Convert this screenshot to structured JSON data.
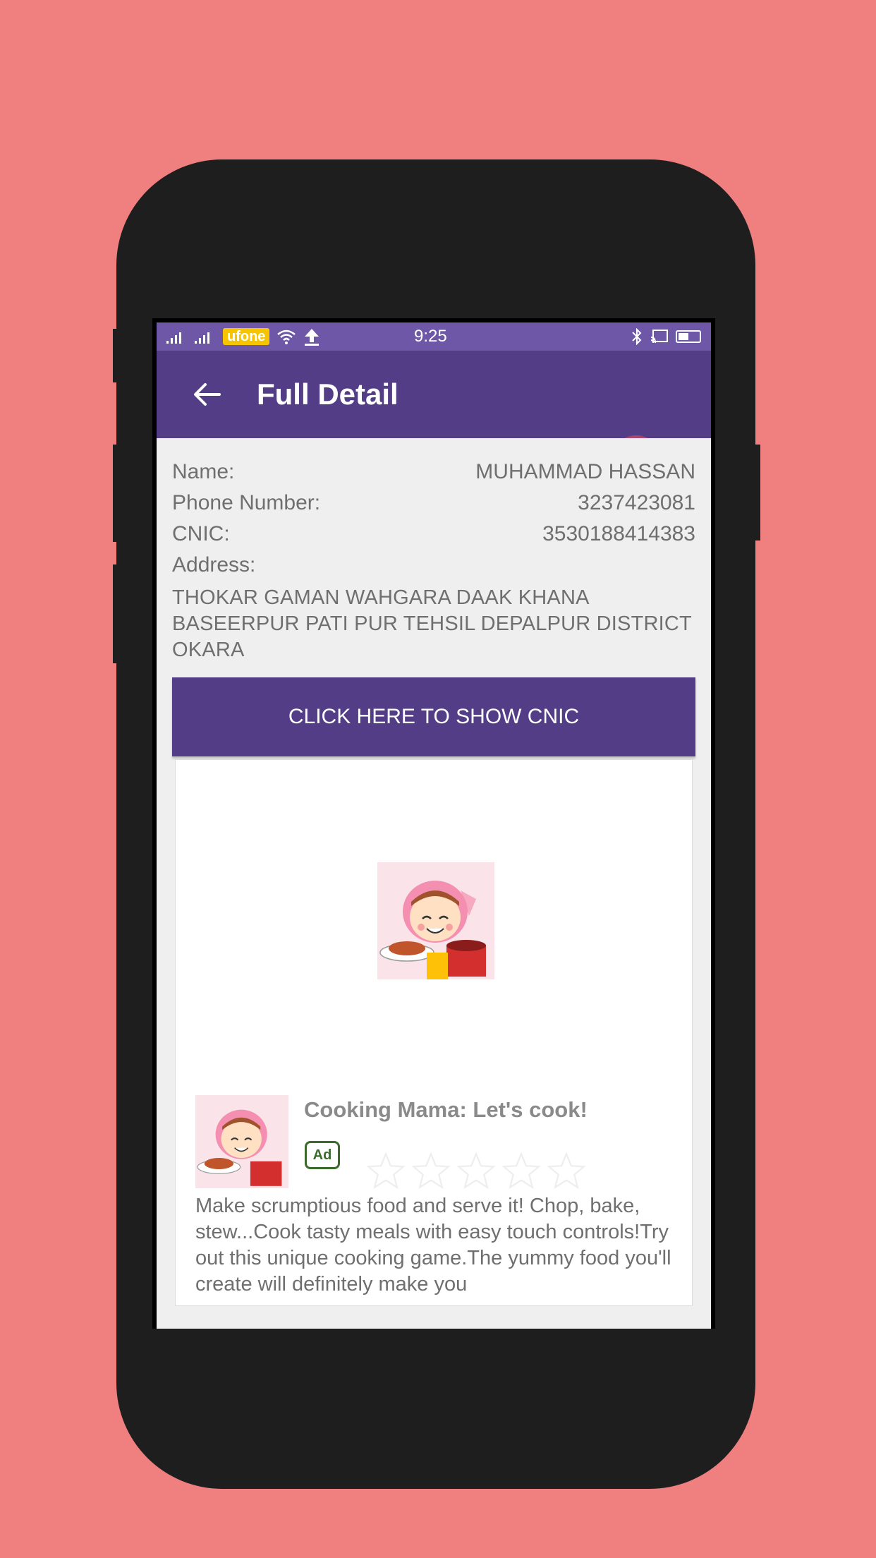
{
  "status_bar": {
    "carrier": "ufone",
    "time": "9:25"
  },
  "app_bar": {
    "title": "Full Detail"
  },
  "details": {
    "name_label": "Name:",
    "name_value": "MUHAMMAD HASSAN",
    "phone_label": "Phone Number:",
    "phone_value": "3237423081",
    "cnic_label": "CNIC:",
    "cnic_value": "3530188414383",
    "address_label": "Address:",
    "address_value": "THOKAR GAMAN WAHGARA DAAK KHANA BASEERPUR PATI PUR TEHSIL DEPALPUR DISTRICT OKARA"
  },
  "cnic_button": {
    "label": "CLICK HERE TO SHOW CNIC"
  },
  "ad": {
    "title": "Cooking Mama: Let's cook!",
    "badge": "Ad",
    "rating_stars": 5,
    "description": "Make scrumptious food and serve it! Chop, bake, stew...Cook tasty meals with easy touch controls!Try out this unique cooking game.The yummy food you'll create will definitely make you"
  },
  "colors": {
    "background": "#f08080",
    "app_bar": "#543d87",
    "status_bar": "#6d57a6",
    "ad_badge": "#3b6b2b"
  }
}
